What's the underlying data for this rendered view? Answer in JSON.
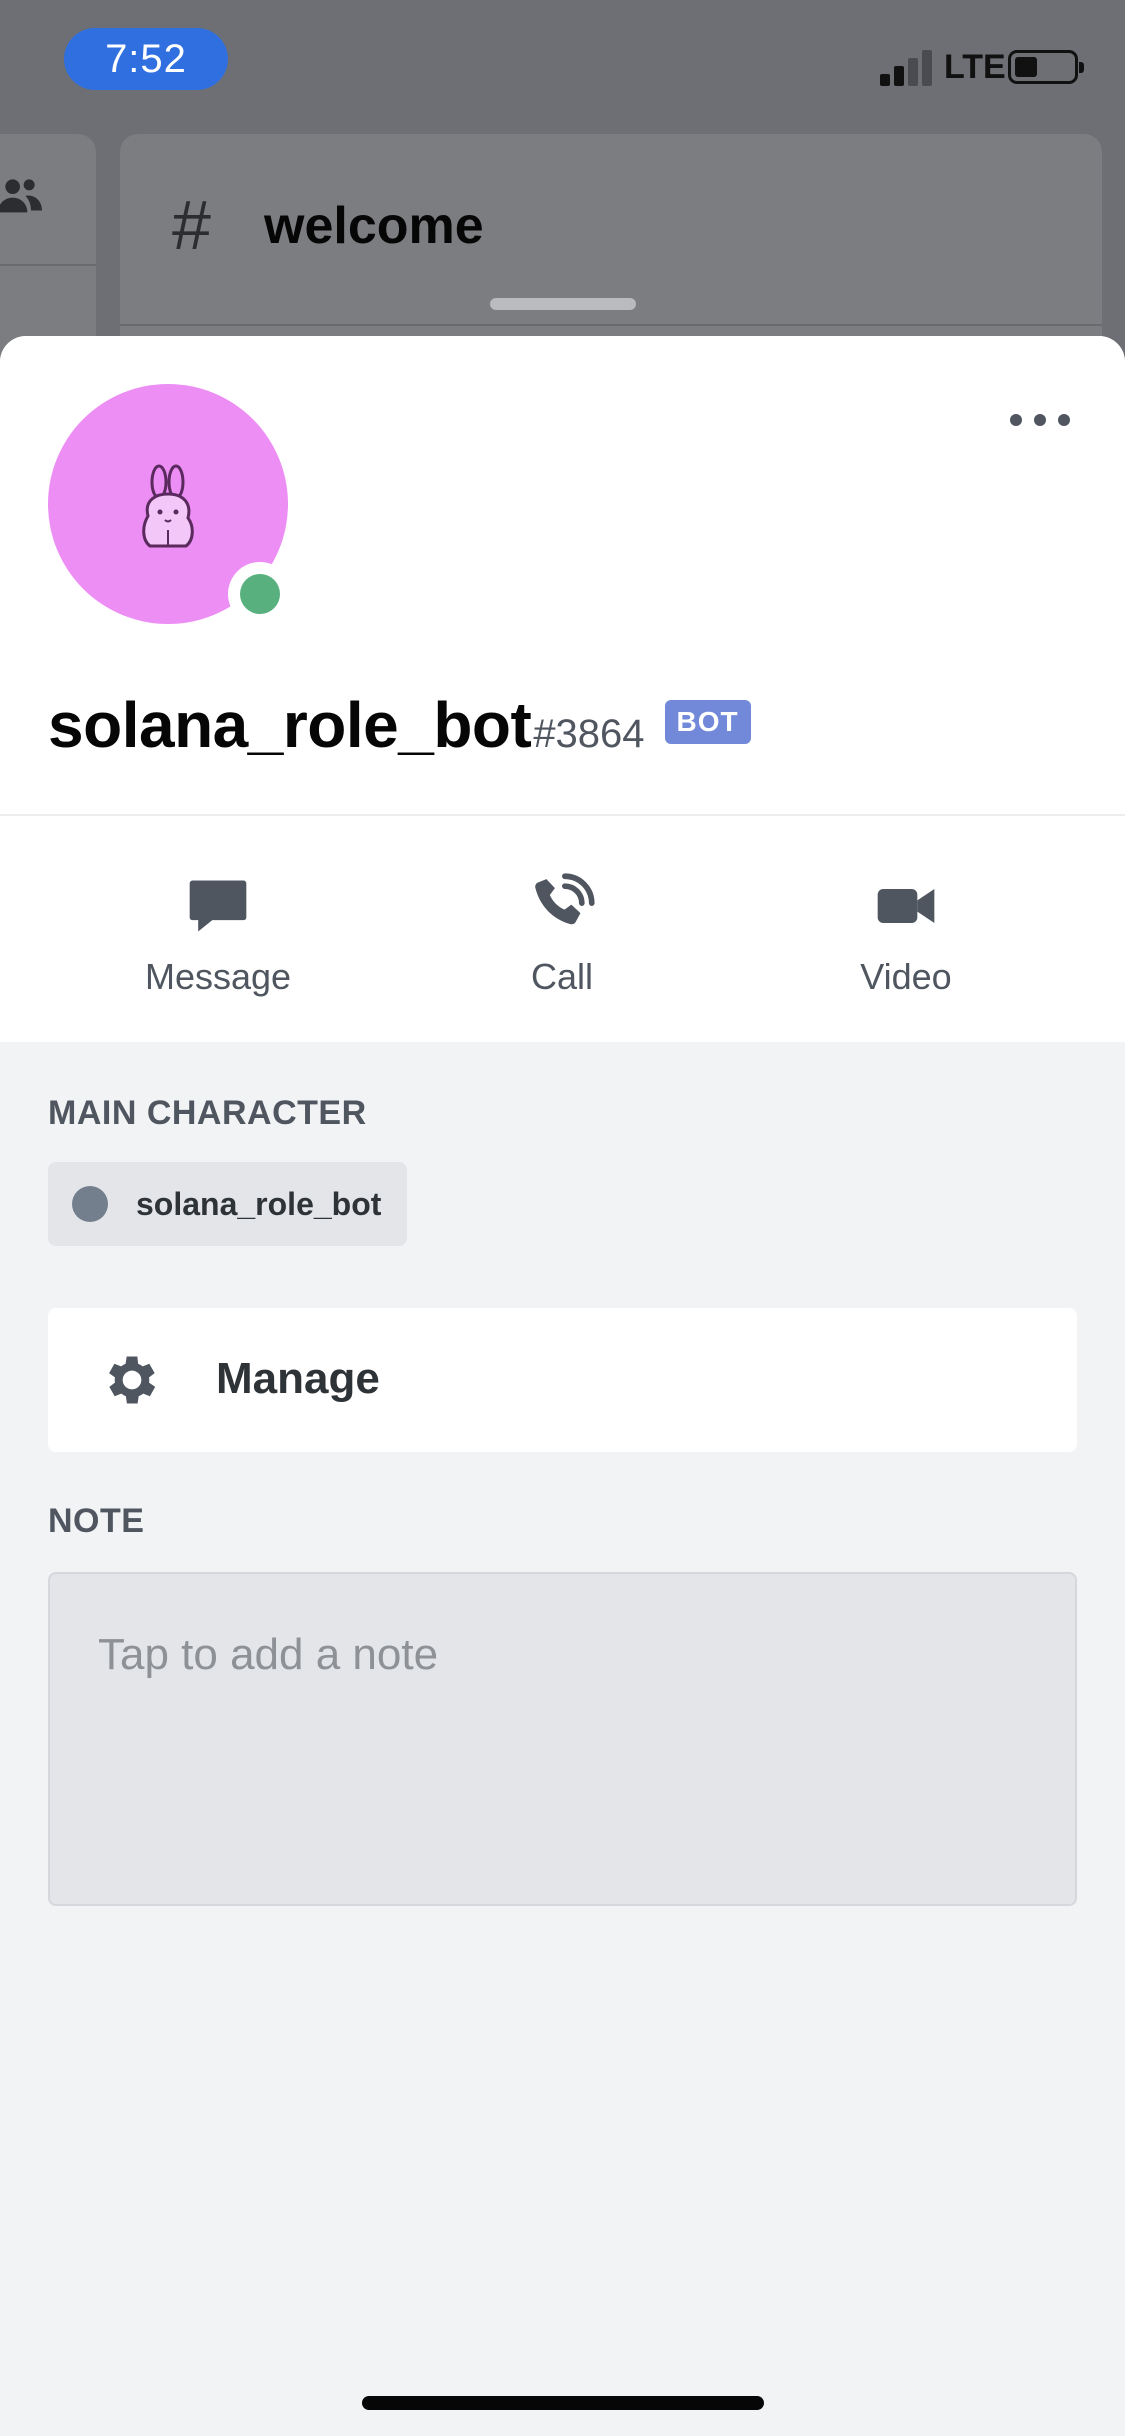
{
  "status_bar": {
    "time": "7:52",
    "network": "LTE",
    "icons": [
      "signal-icon",
      "battery-icon"
    ]
  },
  "background": {
    "channel_prefix": "#",
    "channel_name": "welcome",
    "icons": [
      "members-icon",
      "hash-icon"
    ]
  },
  "profile": {
    "username": "solana_role_bot",
    "discriminator": "#3864",
    "bot_tag": "BOT",
    "avatar_color": "#ed8ef5",
    "presence_color": "#57b07e",
    "more_icon": "more-horizontal-icon"
  },
  "actions": [
    {
      "label": "Message",
      "icon": "message-icon"
    },
    {
      "label": "Call",
      "icon": "phone-icon"
    },
    {
      "label": "Video",
      "icon": "video-camera-icon"
    }
  ],
  "roles": {
    "title": "MAIN CHARACTER",
    "items": [
      {
        "name": "solana_role_bot",
        "color": "#747f8d"
      }
    ]
  },
  "manage": {
    "label": "Manage",
    "icon": "gear-icon"
  },
  "note": {
    "title": "NOTE",
    "placeholder": "Tap to add a note"
  }
}
